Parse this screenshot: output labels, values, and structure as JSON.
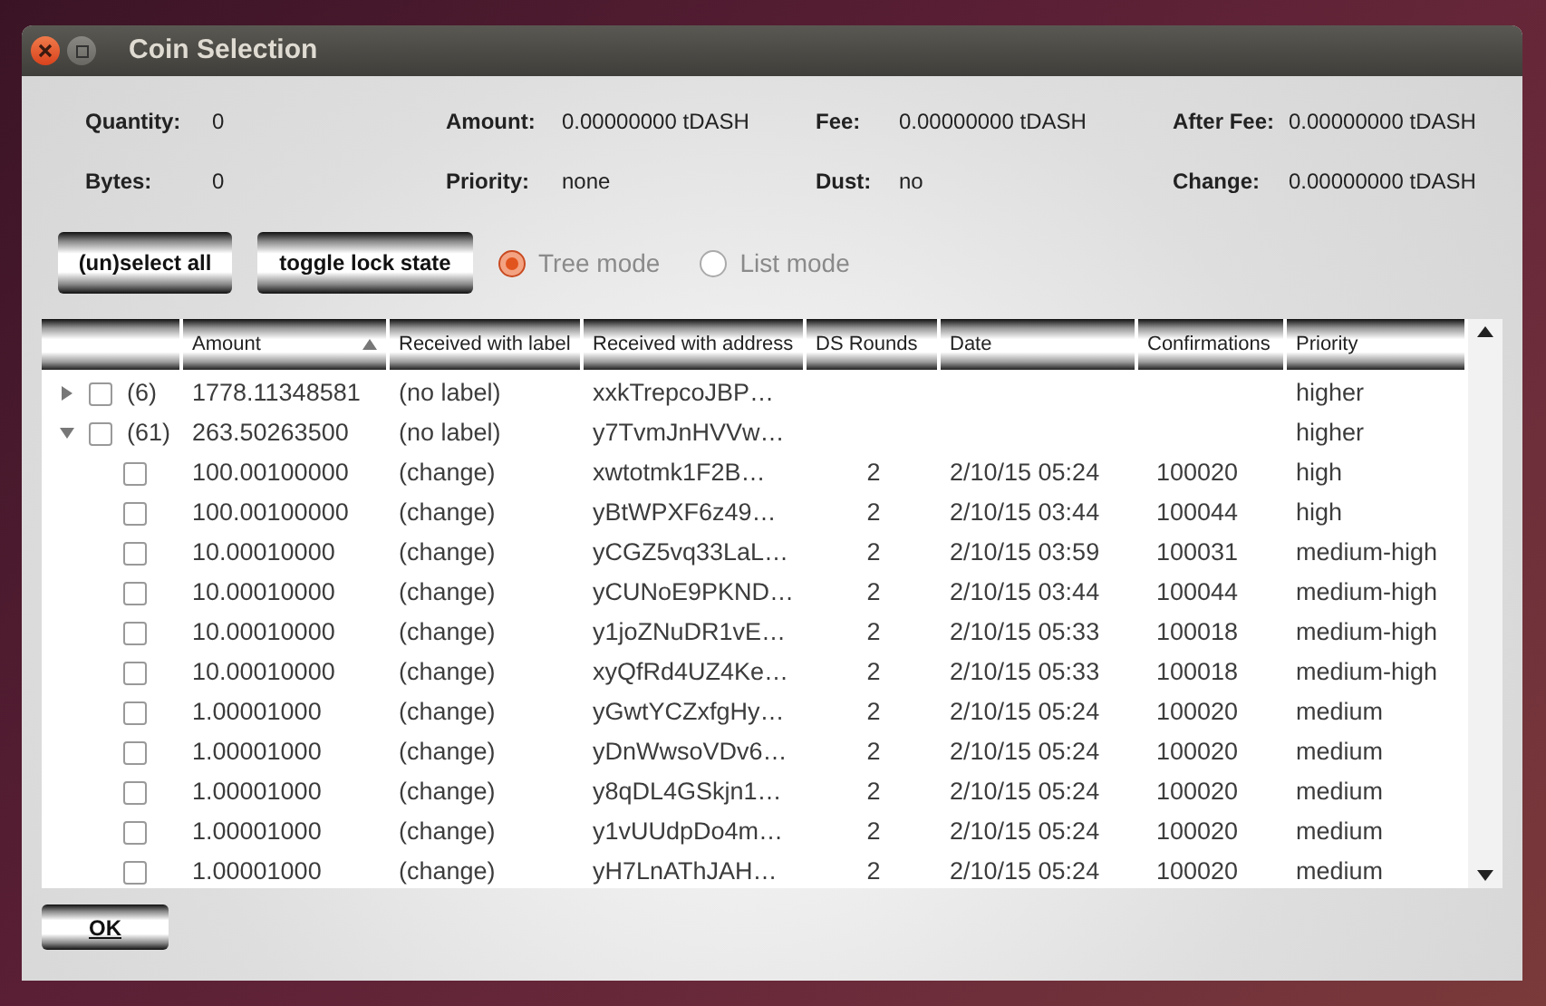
{
  "window": {
    "title": "Coin Selection"
  },
  "summary": [
    {
      "label": "Quantity:",
      "value": "0"
    },
    {
      "label": "Amount:",
      "value": "0.00000000 tDASH"
    },
    {
      "label": "Fee:",
      "value": "0.00000000 tDASH"
    },
    {
      "label": "After Fee:",
      "value": "0.00000000 tDASH"
    },
    {
      "label": "Bytes:",
      "value": "0"
    },
    {
      "label": "Priority:",
      "value": "none"
    },
    {
      "label": "Dust:",
      "value": "no"
    },
    {
      "label": "Change:",
      "value": "0.00000000 tDASH"
    }
  ],
  "buttons": [
    "(un)select all",
    "toggle lock state"
  ],
  "modes": [
    {
      "label": "Tree mode",
      "selected": true
    },
    {
      "label": "List mode",
      "selected": false
    }
  ],
  "table": {
    "columns": [
      "Amount",
      "Received with label",
      "Received with address",
      "DS Rounds",
      "Date",
      "Confirmations",
      "Priority"
    ],
    "rows": [
      {
        "count": "(6)",
        "expanded": false,
        "checked": false,
        "amount": "1778.11348581",
        "label": "(no label)",
        "address": "xxkTrepcoJBP…",
        "priority": "higher"
      },
      {
        "count": "(61)",
        "expanded": true,
        "checked": false,
        "amount": "263.50263500",
        "label": "(no label)",
        "address": "y7TvmJnHVVw…",
        "priority": "higher",
        "children": [
          {
            "checked": false,
            "amount": "100.00100000",
            "label": "(change)",
            "address": "xwtotmk1F2B…",
            "ds_rounds": "2",
            "date": "2/10/15 05:24",
            "confirmations": "100020",
            "priority": "high"
          },
          {
            "checked": false,
            "amount": "100.00100000",
            "label": "(change)",
            "address": "yBtWPXF6z49…",
            "ds_rounds": "2",
            "date": "2/10/15 03:44",
            "confirmations": "100044",
            "priority": "high"
          },
          {
            "checked": false,
            "amount": "10.00010000",
            "label": "(change)",
            "address": "yCGZ5vq33LaL…",
            "ds_rounds": "2",
            "date": "2/10/15 03:59",
            "confirmations": "100031",
            "priority": "medium-high"
          },
          {
            "checked": false,
            "amount": "10.00010000",
            "label": "(change)",
            "address": "yCUNoE9PKND…",
            "ds_rounds": "2",
            "date": "2/10/15 03:44",
            "confirmations": "100044",
            "priority": "medium-high"
          },
          {
            "checked": false,
            "amount": "10.00010000",
            "label": "(change)",
            "address": "y1joZNuDR1vE…",
            "ds_rounds": "2",
            "date": "2/10/15 05:33",
            "confirmations": "100018",
            "priority": "medium-high"
          },
          {
            "checked": false,
            "amount": "10.00010000",
            "label": "(change)",
            "address": "xyQfRd4UZ4Ke…",
            "ds_rounds": "2",
            "date": "2/10/15 05:33",
            "confirmations": "100018",
            "priority": "medium-high"
          },
          {
            "checked": false,
            "amount": "1.00001000",
            "label": "(change)",
            "address": "yGwtYCZxfgHy…",
            "ds_rounds": "2",
            "date": "2/10/15 05:24",
            "confirmations": "100020",
            "priority": "medium"
          },
          {
            "checked": false,
            "amount": "1.00001000",
            "label": "(change)",
            "address": "yDnWwsoVDv6…",
            "ds_rounds": "2",
            "date": "2/10/15 05:24",
            "confirmations": "100020",
            "priority": "medium"
          },
          {
            "checked": false,
            "amount": "1.00001000",
            "label": "(change)",
            "address": "y8qDL4GSkjn1…",
            "ds_rounds": "2",
            "date": "2/10/15 05:24",
            "confirmations": "100020",
            "priority": "medium"
          },
          {
            "checked": false,
            "amount": "1.00001000",
            "label": "(change)",
            "address": "y1vUUdpDo4m…",
            "ds_rounds": "2",
            "date": "2/10/15 05:24",
            "confirmations": "100020",
            "priority": "medium"
          },
          {
            "checked": false,
            "amount": "1.00001000",
            "label": "(change)",
            "address": "yH7LnAThJAH…",
            "ds_rounds": "2",
            "date": "2/10/15 05:24",
            "confirmations": "100020",
            "priority": "medium"
          }
        ]
      }
    ]
  },
  "ok_button": "OK"
}
